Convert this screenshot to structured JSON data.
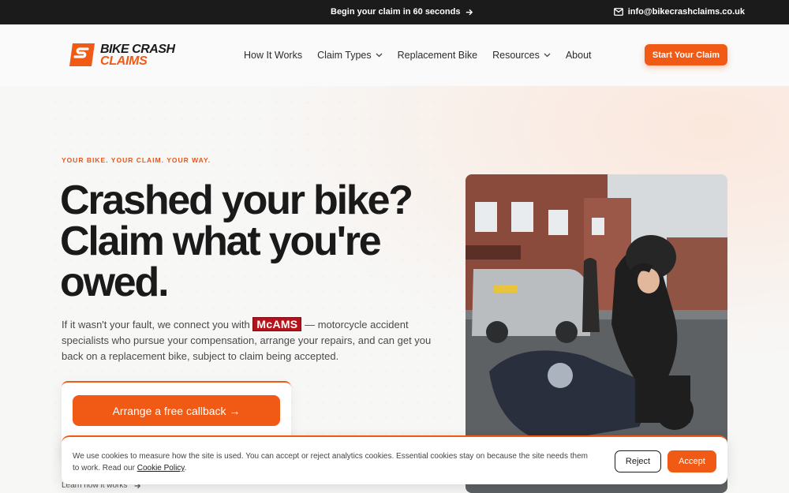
{
  "topbar": {
    "promo_text": "Begin your claim in 60 seconds",
    "email": "info@bikecrashclaims.co.uk"
  },
  "header": {
    "logo_line1": "BIKE CRASH",
    "logo_line2": "CLAIMS",
    "nav": [
      {
        "label": "How It Works",
        "has_dropdown": false
      },
      {
        "label": "Claim Types",
        "has_dropdown": true
      },
      {
        "label": "Replacement Bike",
        "has_dropdown": false
      },
      {
        "label": "Resources",
        "has_dropdown": true
      },
      {
        "label": "About",
        "has_dropdown": false
      }
    ],
    "cta_label": "Start Your Claim"
  },
  "hero": {
    "eyebrow": "YOUR BIKE. YOUR CLAIM. YOUR WAY.",
    "headline": "Crashed your bike? Claim what you're owed.",
    "lede_before": "If it wasn't your fault, we connect you with",
    "partner_logo": "McAMS",
    "lede_after": "— motorcycle accident specialists who pursue your compensation, arrange your repairs, and can get you back on a replacement bike, subject to claim being accepted.",
    "callback_label": "Arrange a free callback →",
    "learn_link": "Learn how it works"
  },
  "cookie": {
    "message": "We use cookies to measure how the site is used. You can accept or reject analytics cookies. Essential cookies stay on because the site needs them to work. Read our",
    "policy_link": "Cookie Policy",
    "reject_label": "Reject",
    "accept_label": "Accept"
  },
  "colors": {
    "accent": "#f05a14",
    "dark": "#1b1b1b",
    "partner_red": "#b5121b"
  }
}
